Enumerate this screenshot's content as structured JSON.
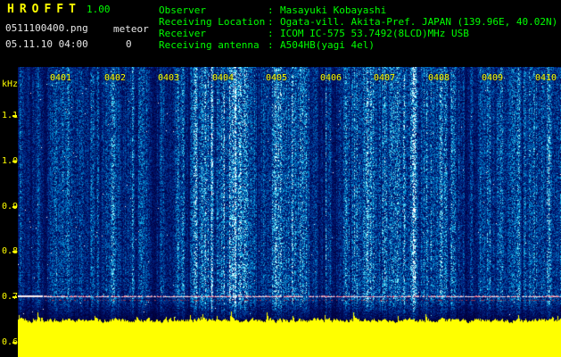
{
  "app": {
    "title": "HROFFT",
    "version": "1.00",
    "filename": "0511100400.png",
    "mode_label": "meteor",
    "meteor_count": "0",
    "datetime": "05.11.10 04:00"
  },
  "info": {
    "separator": ": ",
    "rows": [
      {
        "label": "Observer",
        "value": "Masayuki Kobayashi"
      },
      {
        "label": "Receiving Location",
        "value": "Ogata-vill. Akita-Pref. JAPAN (139.96E, 40.02N)"
      },
      {
        "label": "Receiver",
        "value": "ICOM IC-575 53.7492(8LCD)MHz USB"
      },
      {
        "label": "Receiving antenna",
        "value": "A504HB(yagi 4el)"
      }
    ]
  },
  "chart_data": {
    "type": "heatmap",
    "title": "10-minute radio meteor echo spectrogram (HROFFT output image)",
    "x_ticks": [
      "0401",
      "0402",
      "0403",
      "0404",
      "0405",
      "0406",
      "0407",
      "0408",
      "0409",
      "0410"
    ],
    "ylabel": "kHz",
    "y_ticks": [
      "1.1",
      "1.0",
      "0.9",
      "0.8",
      "0.7",
      "0.6"
    ],
    "y_range_khz": [
      0.57,
      1.21
    ],
    "carrier_line_khz": 0.7,
    "signal_strength_plot": "solid yellow level band along bottom edge",
    "legend": "none",
    "grid": "off",
    "colors": {
      "background": "#000000",
      "noise_low": "#001a60",
      "noise_high": "#7fd4ff",
      "carrier_line": "#ffc8d0",
      "signal_plot": "#ffff00",
      "axis_text": "#ffff00",
      "header_text": "#00ff00",
      "title_text": "#ffff00",
      "file_text": "#ffffff"
    }
  }
}
